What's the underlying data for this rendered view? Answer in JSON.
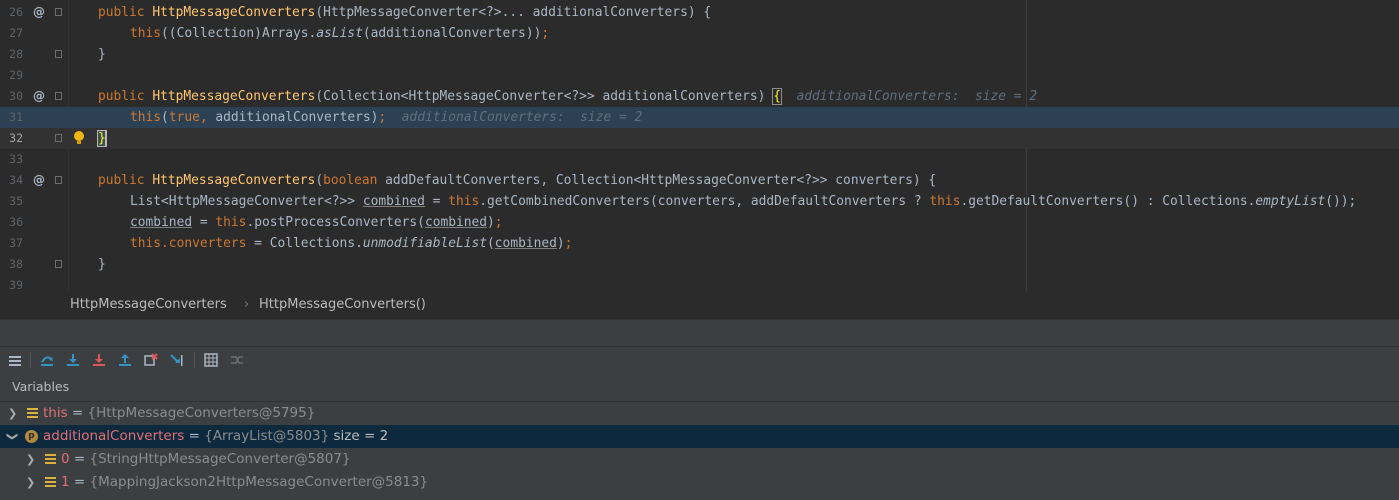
{
  "editor": {
    "lines": {
      "n26": "26",
      "n27": "27",
      "n28": "28",
      "n29": "29",
      "n30": "30",
      "n31": "31",
      "n32": "32",
      "n33": "33",
      "n34": "34",
      "n35": "35",
      "n36": "36",
      "n37": "37",
      "n38": "38",
      "n39": "39"
    },
    "code": {
      "l26_kw": "public ",
      "l26_fn": "HttpMessageConverters",
      "l26_rest": "(HttpMessageConverter<?>... additionalConverters) {",
      "l27_this": "this",
      "l27_a": "((Collection)Arrays.",
      "l27_it": "asList",
      "l27_b": "(additionalConverters))",
      "l27_semi": ";",
      "l28": "}",
      "l30_kw": "public ",
      "l30_fn": "HttpMessageConverters",
      "l30_rest": "(Collection<HttpMessageConverter<?>> additionalConverters) ",
      "l30_brace": "{",
      "l30_hint": "additionalConverters:  size = 2",
      "l31_this": "this",
      "l31_a": "(",
      "l31_true": "true",
      "l31_comma": ", ",
      "l31_b": "additionalConverters)",
      "l31_semi": ";",
      "l31_hint": "additionalConverters:  size = 2",
      "l32": "}",
      "l34_kw": "public ",
      "l34_fn": "HttpMessageConverters",
      "l34_a": "(",
      "l34_bool": "boolean ",
      "l34_rest": "addDefaultConverters, Collection<HttpMessageConverter<?>> converters) {",
      "l35_a": "List<HttpMessageConverter<?>> ",
      "l35_combined": "combined",
      "l35_b": " = ",
      "l35_this1": "this",
      "l35_c": ".getCombinedConverters(converters, addDefaultConverters ? ",
      "l35_this2": "this",
      "l35_d": ".getDefaultConverters() : Collections.",
      "l35_it": "emptyList",
      "l35_e": "());",
      "l36_combined": "combined",
      "l36_b": " = ",
      "l36_this": "this",
      "l36_c": ".postProcessConverters(",
      "l36_combined2": "combined",
      "l36_d": ")",
      "l36_semi": ";",
      "l37_this": "this",
      "l37_field": ".converters",
      "l37_b": " = Collections.",
      "l37_it": "unmodifiableList",
      "l37_c": "(",
      "l37_combined": "combined",
      "l37_d": ")",
      "l37_semi": ";",
      "l38": "}"
    }
  },
  "breadcrumb": {
    "class_name": "HttpMessageConverters",
    "separator": "›",
    "method_name": "HttpMessageConverters()"
  },
  "debugger": {
    "toolbar_icons": [
      "list-icon",
      "step-over-icon",
      "step-into-icon",
      "force-step-into-icon",
      "step-out-icon",
      "drop-frame-icon",
      "run-to-cursor-icon",
      "evaluate-icon",
      "trace-icon"
    ],
    "variables_title": "Variables",
    "variables": [
      {
        "name": "this",
        "eq": " = ",
        "value": "{HttpMessageConverters@5795}",
        "extra": ""
      },
      {
        "name": "additionalConverters",
        "eq": " = ",
        "value": "{ArrayList@5803}",
        "extra": "  size = 2",
        "badge": "p"
      },
      {
        "name": "0",
        "eq": " = ",
        "value": "{StringHttpMessageConverter@5807}",
        "extra": ""
      },
      {
        "name": "1",
        "eq": " = ",
        "value": "{MappingJackson2HttpMessageConverter@5813}",
        "extra": ""
      }
    ]
  },
  "colors": {
    "keyword": "#cc7832",
    "method": "#ffc66d",
    "exec_line": "#2d4154",
    "selected_row": "#0d293e"
  }
}
